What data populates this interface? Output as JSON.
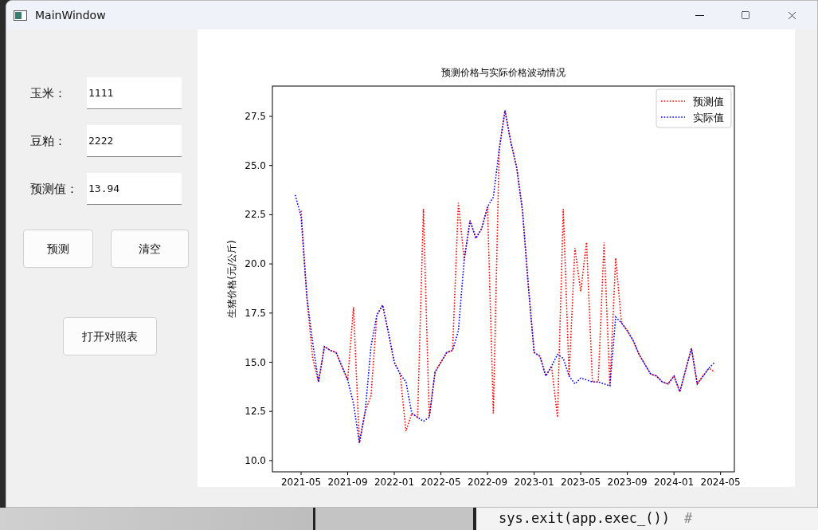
{
  "window": {
    "title": "MainWindow"
  },
  "form": {
    "fields": [
      {
        "label": "玉米：",
        "value": "1111"
      },
      {
        "label": "豆粕：",
        "value": "2222"
      },
      {
        "label": "预测值：",
        "value": "13.94"
      }
    ],
    "buttons": [
      "预测",
      "清空"
    ],
    "table_button": "打开对照表"
  },
  "chart": {
    "chart_data": {
      "type": "line",
      "title": "预测价格与实际价格波动情况",
      "ylabel": "生猪价格(元/公斤)",
      "categories": [
        null,
        "2021-05",
        null,
        null,
        null,
        null,
        null,
        null,
        null,
        "2021-09",
        null,
        null,
        null,
        null,
        null,
        null,
        null,
        "2022-01",
        null,
        null,
        null,
        null,
        null,
        null,
        null,
        "2022-05",
        null,
        null,
        null,
        null,
        null,
        null,
        null,
        "2022-09",
        null,
        null,
        null,
        null,
        null,
        null,
        null,
        "2023-01",
        null,
        null,
        null,
        null,
        null,
        null,
        null,
        "2023-05",
        null,
        null,
        null,
        null,
        null,
        null,
        null,
        "2023-09",
        null,
        null,
        null,
        null,
        null,
        null,
        null,
        "2024-01",
        null,
        null,
        null,
        null,
        null,
        null,
        null,
        "2024-05"
      ],
      "series": [
        {
          "name": "预测值",
          "color": "#ff0000",
          "line_style": "dotted",
          "values": [
            null,
            22.7,
            18.3,
            15.2,
            14.0,
            15.8,
            15.6,
            15.5,
            14.8,
            14.1,
            17.8,
            10.9,
            12.5,
            13.3,
            17.4,
            17.9,
            16.5,
            15.0,
            14.4,
            11.5,
            12.4,
            12.2,
            22.8,
            12.2,
            14.5,
            15.0,
            15.5,
            15.6,
            23.1,
            20.2,
            22.2,
            21.3,
            21.8,
            22.9,
            12.4,
            25.8,
            27.8,
            26.2,
            24.9,
            22.7,
            18.9,
            15.5,
            15.3,
            14.3,
            14.8,
            12.2,
            22.8,
            14.3,
            20.8,
            18.6,
            21.1,
            14.0,
            14.0,
            21.1,
            13.8,
            20.3,
            17.0,
            16.6,
            16.1,
            15.4,
            14.9,
            14.4,
            14.3,
            14.0,
            13.9,
            14.3,
            13.5,
            14.6,
            15.7,
            13.9,
            14.3,
            14.7,
            14.5,
            null
          ]
        },
        {
          "name": "实际值",
          "color": "#0000ff",
          "line_style": "dotted",
          "values": [
            23.5,
            22.4,
            18.3,
            16.0,
            14.0,
            15.8,
            15.6,
            15.5,
            14.8,
            14.1,
            12.9,
            10.9,
            12.5,
            15.8,
            17.4,
            17.9,
            16.5,
            15.0,
            14.4,
            14.0,
            12.4,
            12.2,
            12.0,
            12.2,
            14.5,
            15.0,
            15.5,
            15.6,
            16.6,
            20.2,
            22.2,
            21.3,
            21.8,
            22.9,
            23.4,
            25.8,
            27.8,
            26.2,
            24.9,
            22.7,
            18.9,
            15.5,
            15.3,
            14.3,
            14.8,
            15.4,
            15.2,
            14.3,
            13.9,
            14.2,
            14.1,
            14.0,
            14.0,
            13.9,
            13.8,
            17.3,
            17.0,
            16.6,
            16.1,
            15.4,
            14.9,
            14.4,
            14.3,
            14.0,
            13.9,
            14.3,
            13.5,
            14.6,
            15.7,
            13.9,
            14.3,
            14.7,
            15.0,
            null
          ]
        }
      ],
      "legend": "upper right",
      "ylim": [
        9.43,
        29.04
      ],
      "yticks": [
        {
          "value": 10,
          "label": "10.0"
        },
        {
          "value": 12.5,
          "label": "12.5"
        },
        {
          "value": 15,
          "label": "15.0"
        },
        {
          "value": 17.5,
          "label": "17.5"
        },
        {
          "value": 20,
          "label": "20.0"
        },
        {
          "value": 22.5,
          "label": "22.5"
        },
        {
          "value": 25,
          "label": "25.0"
        },
        {
          "value": 27.5,
          "label": "27.5"
        }
      ]
    }
  },
  "background_editor": {
    "code": "sys.exit(app.exec_())",
    "comment": "#"
  }
}
